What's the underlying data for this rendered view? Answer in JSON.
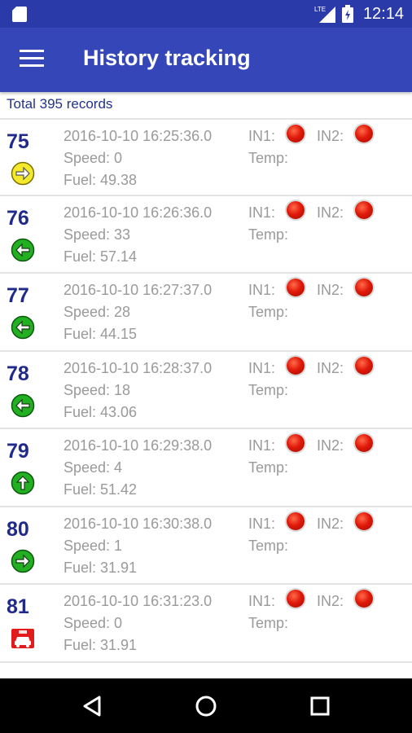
{
  "status_bar": {
    "time": "12:14",
    "network": "LTE",
    "sim_icon": "sim-card-icon",
    "signal_icon": "signal-icon",
    "battery_icon": "battery-icon"
  },
  "app_bar": {
    "title": "History tracking",
    "menu_icon": "hamburger-menu-icon"
  },
  "summary": {
    "total_text": "Total 395 records"
  },
  "records": [
    {
      "id": "75",
      "datetime": "2016-10-10 16:25:36.0",
      "speed": "Speed: 0",
      "fuel": "Fuel: 49.38",
      "in1": "IN1:",
      "in2": "IN2:",
      "temp": "Temp:",
      "direction_icon": "arrow-right-yellow-icon"
    },
    {
      "id": "76",
      "datetime": "2016-10-10 16:26:36.0",
      "speed": "Speed: 33",
      "fuel": "Fuel: 57.14",
      "in1": "IN1:",
      "in2": "IN2:",
      "temp": "Temp:",
      "direction_icon": "arrow-left-green-icon"
    },
    {
      "id": "77",
      "datetime": "2016-10-10 16:27:37.0",
      "speed": "Speed: 28",
      "fuel": "Fuel: 44.15",
      "in1": "IN1:",
      "in2": "IN2:",
      "temp": "Temp:",
      "direction_icon": "arrow-left-green-icon"
    },
    {
      "id": "78",
      "datetime": "2016-10-10 16:28:37.0",
      "speed": "Speed: 18",
      "fuel": "Fuel: 43.06",
      "in1": "IN1:",
      "in2": "IN2:",
      "temp": "Temp:",
      "direction_icon": "arrow-left-green-icon"
    },
    {
      "id": "79",
      "datetime": "2016-10-10 16:29:38.0",
      "speed": "Speed: 4",
      "fuel": "Fuel: 51.42",
      "in1": "IN1:",
      "in2": "IN2:",
      "temp": "Temp:",
      "direction_icon": "arrow-up-green-icon"
    },
    {
      "id": "80",
      "datetime": "2016-10-10 16:30:38.0",
      "speed": "Speed: 1",
      "fuel": "Fuel: 31.91",
      "in1": "IN1:",
      "in2": "IN2:",
      "temp": "Temp:",
      "direction_icon": "arrow-right-green-icon"
    },
    {
      "id": "81",
      "datetime": "2016-10-10 16:31:23.0",
      "speed": "Speed: 0",
      "fuel": "Fuel: 31.91",
      "in1": "IN1:",
      "in2": "IN2:",
      "temp": "Temp:",
      "direction_icon": "parked-car-red-icon"
    }
  ],
  "nav_bar": {
    "back_icon": "back-icon",
    "home_icon": "home-icon",
    "recents_icon": "recents-icon"
  },
  "colors": {
    "status_bar": "#2a3aa8",
    "app_bar": "#3547b8",
    "record_number": "#1f2a8c",
    "secondary_text": "#9a9a9a",
    "led_red": "#e11a0a"
  }
}
